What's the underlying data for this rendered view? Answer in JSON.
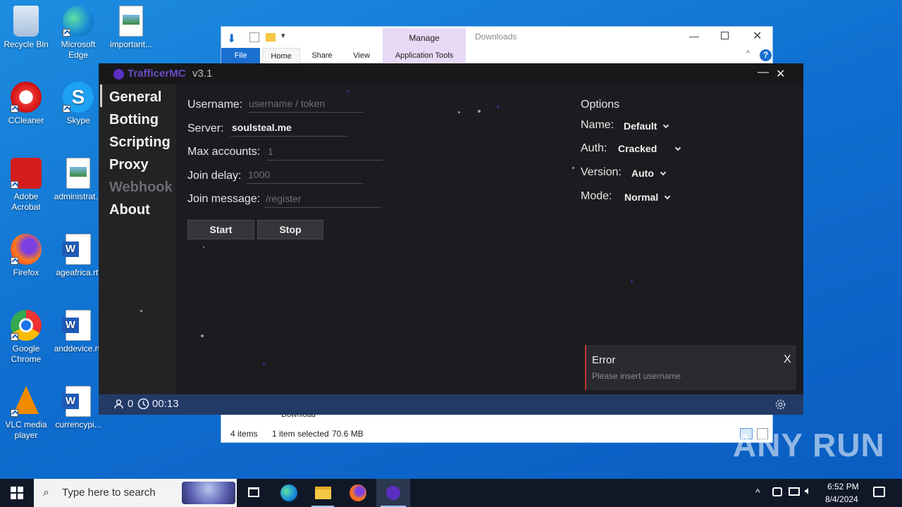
{
  "desktop": {
    "icons": [
      {
        "label": "Recycle Bin",
        "icon": "recycle-bin-icon"
      },
      {
        "label": "Microsoft Edge",
        "icon": "edge-icon"
      },
      {
        "label": "important...",
        "icon": "image-file-icon"
      },
      {
        "label": "CCleaner",
        "icon": "ccleaner-icon"
      },
      {
        "label": "Skype",
        "icon": "skype-icon"
      },
      {
        "label": "Adobe Acrobat",
        "icon": "acrobat-icon"
      },
      {
        "label": "administrat...",
        "icon": "image-file-icon"
      },
      {
        "label": "Firefox",
        "icon": "firefox-icon"
      },
      {
        "label": "ageafrica.rtf",
        "icon": "word-doc-icon"
      },
      {
        "label": "Google Chrome",
        "icon": "chrome-icon"
      },
      {
        "label": "anddevice.rtf",
        "icon": "word-doc-icon"
      },
      {
        "label": "VLC media player",
        "icon": "vlc-icon"
      },
      {
        "label": "currencypi...",
        "icon": "word-doc-icon"
      }
    ]
  },
  "explorer": {
    "manage_label": "Manage",
    "title": "Downloads",
    "tabs": {
      "file": "File",
      "home": "Home",
      "share": "Share",
      "view": "View",
      "app_tools": "Application Tools"
    },
    "nav_item": "Download",
    "status": {
      "items": "4 items",
      "selected": "1 item selected",
      "size": "70.6 MB"
    }
  },
  "app": {
    "title": "TrafficerMC",
    "version": "v3.1",
    "nav": {
      "general": "General",
      "botting": "Botting",
      "scripting": "Scripting",
      "proxy": "Proxy",
      "webhook": "Webhook",
      "about": "About"
    },
    "form": {
      "username_label": "Username:",
      "username_placeholder": "username / token",
      "server_label": "Server:",
      "server_value": "soulsteal.me",
      "max_label": "Max accounts:",
      "max_placeholder": "1",
      "delay_label": "Join delay:",
      "delay_placeholder": "1000",
      "message_label": "Join message:",
      "message_placeholder": "/register"
    },
    "buttons": {
      "start": "Start",
      "stop": "Stop"
    },
    "options": {
      "title": "Options",
      "name_label": "Name:",
      "name_value": "Default",
      "auth_label": "Auth:",
      "auth_value": "Cracked",
      "version_label": "Version:",
      "version_value": "Auto",
      "mode_label": "Mode:",
      "mode_value": "Normal"
    },
    "footer": {
      "count": "0",
      "timer": "00:13"
    },
    "toast": {
      "title": "Error",
      "message": "Please insert username",
      "close": "X"
    },
    "window_controls": {
      "minimize": "—",
      "close": "✕"
    }
  },
  "taskbar": {
    "search_placeholder": "Type here to search",
    "time": "6:52 PM",
    "date": "8/4/2024"
  },
  "watermark": "ANY RUN",
  "colors": {
    "app_bg": "#1c1c20",
    "footer": "#233a66",
    "error_accent": "#c0392b",
    "purple": "#5b2fc0"
  }
}
